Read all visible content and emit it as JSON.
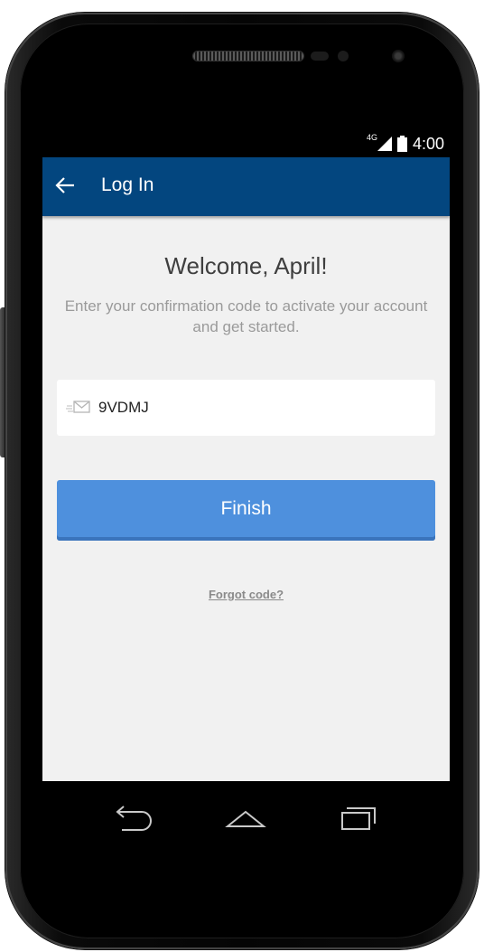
{
  "status_bar": {
    "network": "4G",
    "time": "4:00"
  },
  "app_bar": {
    "back_icon": "arrow-left-icon",
    "title": "Log In",
    "color": "#03467f"
  },
  "main": {
    "welcome": "Welcome, April!",
    "instructions": "Enter your confirmation code to activate your account and get started.",
    "code_input": {
      "icon": "envelope-icon",
      "value": "9VDMJ"
    },
    "finish_label": "Finish",
    "finish_color": "#4e90dd",
    "forgot_link": "Forgot code?",
    "background": "#f1f1f1"
  },
  "nav_bar": {
    "back_icon": "nav-back-icon",
    "home_icon": "nav-home-icon",
    "recents_icon": "nav-recents-icon"
  }
}
